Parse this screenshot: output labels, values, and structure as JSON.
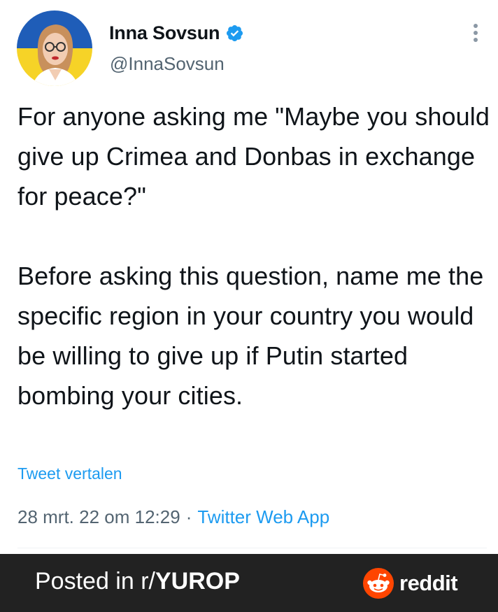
{
  "tweet": {
    "display_name": "Inna Sovsun",
    "handle": "@InnaSovsun",
    "verified": true,
    "text_paragraphs": [
      "For anyone asking me \"Maybe you should give up Crimea and Donbas in exchange for peace?\"",
      "Before asking this question, name me the specific region in your country you would be willing to give up if Putin started bombing your cities."
    ],
    "translate_label": "Tweet vertalen",
    "date": "28 mrt. 22 om 12:29",
    "separator": "·",
    "source": "Twitter Web App"
  },
  "icons": {
    "avatar": "profile-photo-ukraine-flag",
    "verified": "verified-badge-icon",
    "more": "more-vertical-icon",
    "reddit": "reddit-snoo-icon"
  },
  "footer": {
    "posted_prefix": "Posted in r/",
    "subreddit": "YUROP",
    "brand": "reddit"
  },
  "colors": {
    "text": "#0f1419",
    "secondary": "#536471",
    "link": "#1d9bf0",
    "footer_bg": "#222222",
    "reddit_orange": "#ff4500",
    "flag_blue": "#1f5db8",
    "flag_yellow": "#f6d327"
  }
}
